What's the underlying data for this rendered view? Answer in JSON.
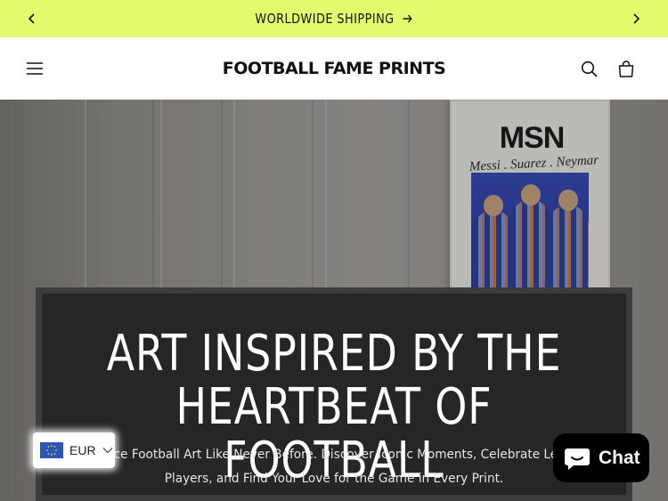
{
  "announcement": {
    "text": "WORLDWIDE SHIPPING",
    "icons": {
      "prev": "chevron-left-icon",
      "next": "chevron-right-icon",
      "link": "arrow-right-icon"
    }
  },
  "header": {
    "logo": "FOOTBALL FAME PRINTS",
    "icons": {
      "menu": "hamburger-menu-icon",
      "search": "search-icon",
      "cart": "shopping-bag-icon"
    }
  },
  "hero": {
    "poster": {
      "title": "MSN",
      "subtitle": "Messi . Suarez . Neymar"
    },
    "heading": "ART INSPIRED BY THE HEARTBEAT OF FOOTBALL",
    "description": "Experience Football Art Like Never Before. Discover Iconic Moments, Celebrate Legendary Players, and Find Your Love for the Game in Every Print."
  },
  "currency": {
    "code": "EUR",
    "icons": {
      "flag": "eu-flag-icon",
      "dropdown": "chevron-down-icon"
    }
  },
  "chat": {
    "label": "Chat",
    "icon": "chat-bubble-icon"
  },
  "colors": {
    "announcement_bg": "#e3fb6d",
    "hero_box_bg": "#262626",
    "chat_bg": "#000000",
    "flag_bg": "#2c55b8"
  }
}
